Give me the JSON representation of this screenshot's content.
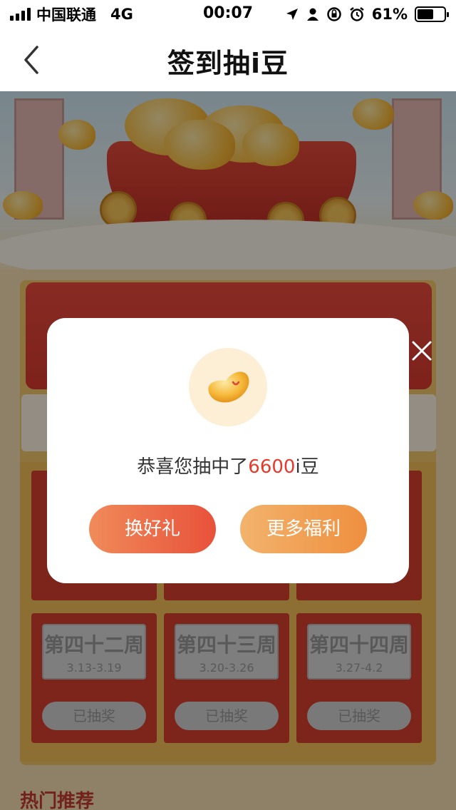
{
  "status_bar": {
    "carrier": "中国联通",
    "network": "4G",
    "time": "00:07",
    "battery_percent": "61%",
    "battery_level": 0.61
  },
  "nav": {
    "title": "签到抽i豆"
  },
  "background": {
    "weeks": [
      {
        "label": "第四十二周",
        "dates": "3.13-3.19",
        "status": "已抽奖"
      },
      {
        "label": "第四十三周",
        "dates": "3.20-3.26",
        "status": "已抽奖"
      },
      {
        "label": "第四十四周",
        "dates": "3.27-4.2",
        "status": "已抽奖"
      }
    ],
    "hot_title": "热门推荐"
  },
  "modal": {
    "message_prefix": "恭喜您抽中了",
    "amount": "6600",
    "unit": "i豆",
    "primary_button": "换好礼",
    "secondary_button": "更多福利"
  },
  "colors": {
    "accent_red": "#e8392d",
    "button_red_start": "#f08b5a",
    "button_red_end": "#e8513a",
    "button_orange_start": "#f2b36c",
    "button_orange_end": "#ef8f3f"
  }
}
